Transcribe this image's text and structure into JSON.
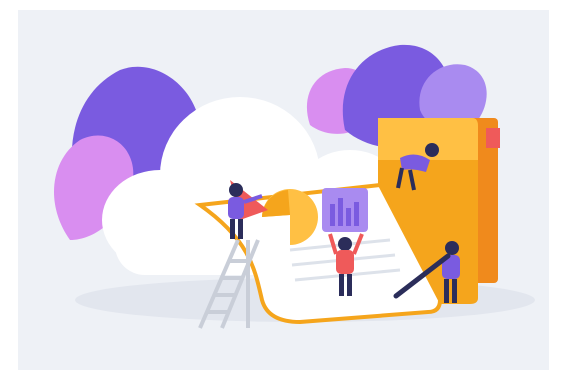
{
  "illustration": {
    "subject": "cloud-storage-illustration",
    "colors": {
      "background": "#eef1f6",
      "purple": "#7a5be0",
      "lilac": "#a98bf0",
      "pink": "#d98ef0",
      "orange": "#f5a51c",
      "orange_light": "#ffc044",
      "cloud": "#ffffff",
      "dark_navy": "#2b2d5a",
      "red_coral": "#ef5a5a"
    },
    "icons": [
      "cloud-icon",
      "folder-icon",
      "ladder-icon",
      "pie-chart-icon",
      "bar-chart-card-icon",
      "pencil-icon",
      "person-icon",
      "leaf-decoration"
    ]
  }
}
